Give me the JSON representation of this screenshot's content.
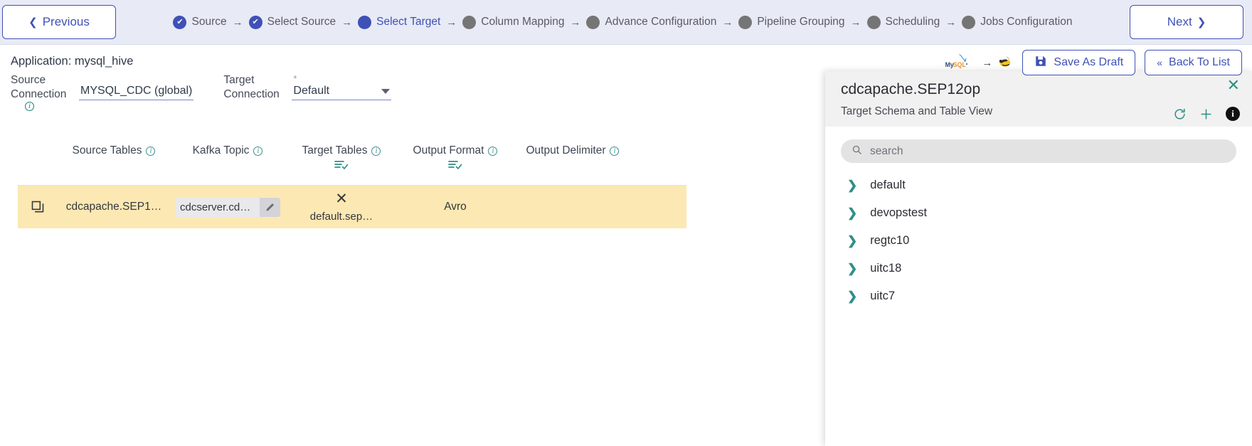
{
  "topbar": {
    "previous_label": "Previous",
    "next_label": "Next",
    "steps": [
      {
        "label": "Source",
        "state": "done"
      },
      {
        "label": "Select Source",
        "state": "done"
      },
      {
        "label": "Select Target",
        "state": "active"
      },
      {
        "label": "Column Mapping",
        "state": "todo"
      },
      {
        "label": "Advance Configuration",
        "state": "todo"
      },
      {
        "label": "Pipeline Grouping",
        "state": "todo"
      },
      {
        "label": "Scheduling",
        "state": "todo"
      },
      {
        "label": "Jobs Configuration",
        "state": "todo"
      }
    ],
    "arrow": "→",
    "check": "✔"
  },
  "header": {
    "application_label": "Application: mysql_hive",
    "source_connection_label": "Source Connection",
    "source_connection_value": "MYSQL_CDC (global)",
    "target_connection_label": "Target Connection",
    "target_connection_value": "Default",
    "target_required_marker": "*",
    "source_logo": "mysql-logo",
    "logo_arrow": "→",
    "target_logo": "hive-logo",
    "save_draft_label": "Save As Draft",
    "back_to_list_label": "Back To List"
  },
  "table": {
    "columns": [
      {
        "label": "Source Tables",
        "has_info": true,
        "has_filter": false
      },
      {
        "label": "Kafka Topic",
        "has_info": true,
        "has_filter": false
      },
      {
        "label": "Target Tables",
        "has_info": true,
        "has_filter": true
      },
      {
        "label": "Output Format",
        "has_info": true,
        "has_filter": true
      },
      {
        "label": "Output Delimiter",
        "has_info": true,
        "has_filter": false
      }
    ],
    "rows": [
      {
        "row_icon": "copy-icon",
        "source_table": "cdcapache.SEP1…",
        "kafka_topic": "cdcserver.cdc…",
        "kafka_edit_icon": "pencil-icon",
        "target_remove_icon": "close-icon",
        "target_table": "default.sep…",
        "output_format": "Avro",
        "output_delimiter": ""
      }
    ]
  },
  "panel": {
    "title": "cdcapache.SEP12op",
    "subtitle": "Target Schema and Table View",
    "close_icon": "close-icon",
    "refresh_icon": "refresh-icon",
    "add_icon": "plus-icon",
    "info_icon": "info-icon",
    "search_placeholder": "search",
    "search_value": "",
    "search_icon": "search-icon",
    "tree_items": [
      {
        "label": "default",
        "expanded": false
      },
      {
        "label": "devopstest",
        "expanded": false
      },
      {
        "label": "regtc10",
        "expanded": false
      },
      {
        "label": "uitc18",
        "expanded": false
      },
      {
        "label": "uitc7",
        "expanded": false
      }
    ],
    "chevron_icon": "chevron-right-icon"
  },
  "colors": {
    "accent_indigo": "#3f51b5",
    "teal": "#2f8f86",
    "row_highlight": "#fce8b2",
    "topbar_bg": "#e8eaf6"
  }
}
